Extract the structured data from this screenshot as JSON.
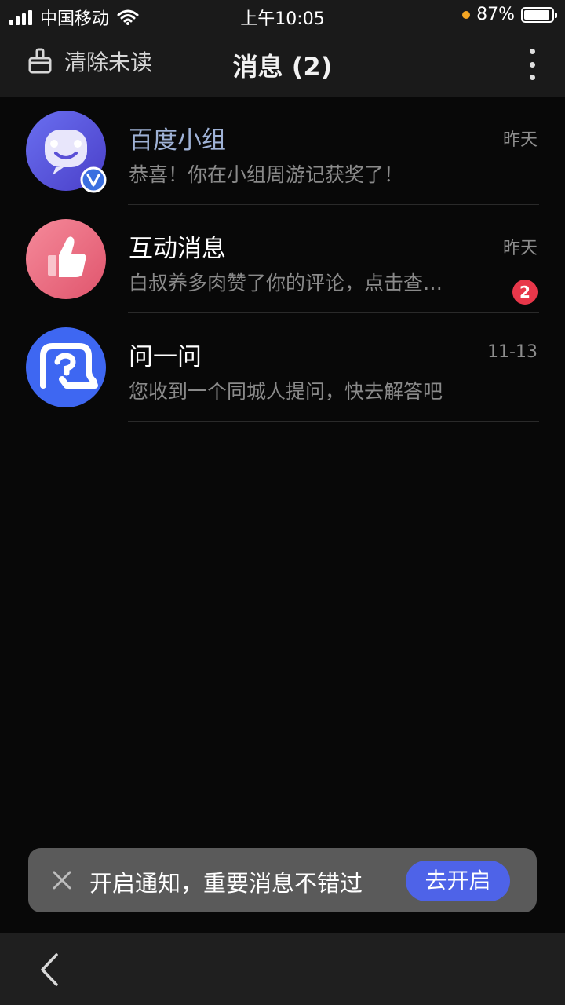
{
  "status_bar": {
    "carrier": "中国移动",
    "time": "上午10:05",
    "battery": "87%"
  },
  "nav": {
    "clear_label": "清除未读",
    "title": "消息 (2)"
  },
  "messages": [
    {
      "title": "百度小组",
      "time": "昨天",
      "preview": "恭喜！你在小组周游记获奖了！",
      "title_color": "#9fb2d6"
    },
    {
      "title": "互动消息",
      "time": "昨天",
      "preview": "白叔养多肉赞了你的评论，点击查…",
      "badge": "2",
      "title_color": "#ffffff"
    },
    {
      "title": "问一问",
      "time": "11-13",
      "preview": "您收到一个同城人提问，快去解答吧",
      "title_color": "#ffffff"
    }
  ],
  "toast": {
    "text": "开启通知，重要消息不错过",
    "button": "去开启"
  },
  "colors": {
    "accent": "#4e63e8",
    "badge": "#e8374a",
    "background": "#080808"
  }
}
